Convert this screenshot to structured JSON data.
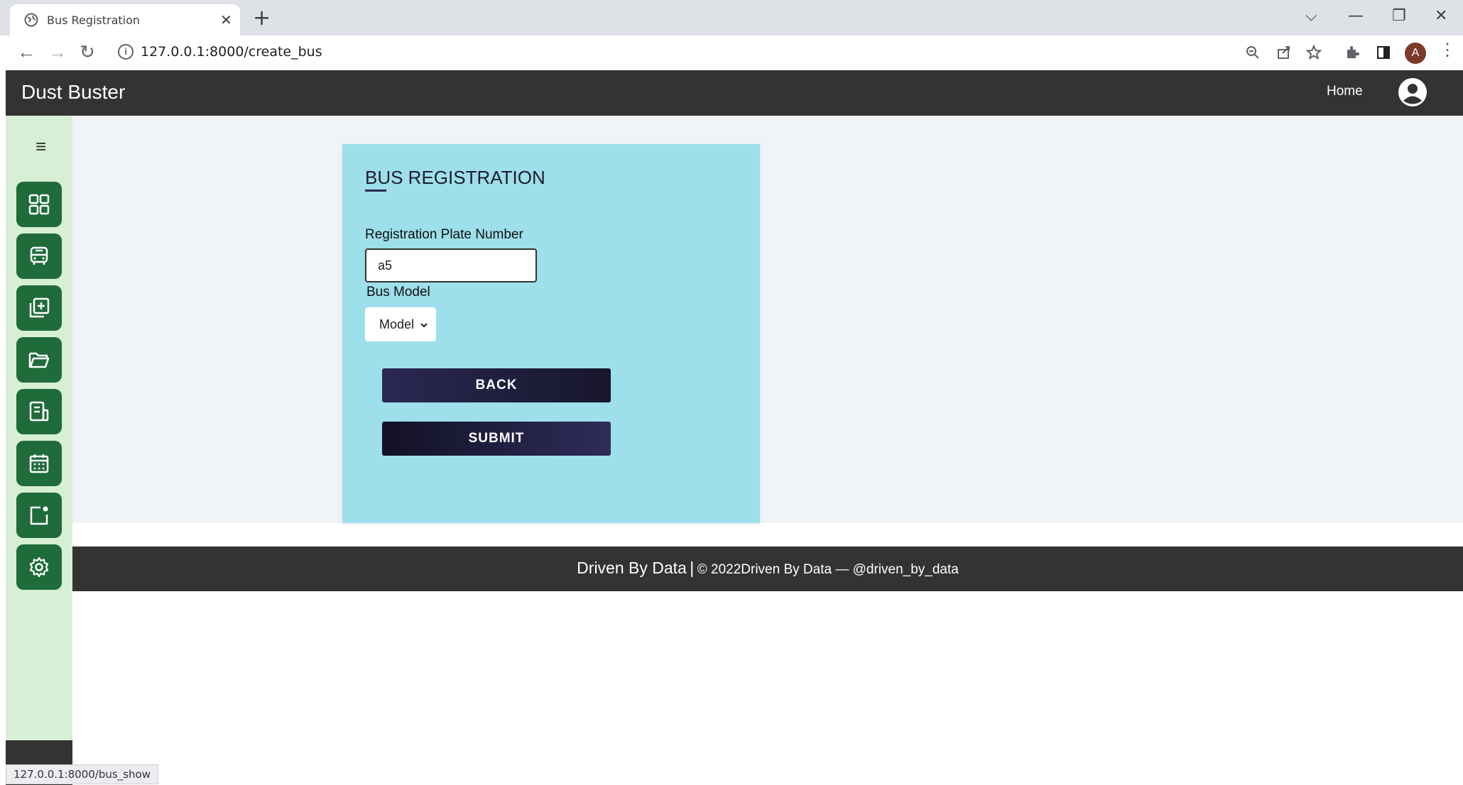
{
  "browser": {
    "tab_title": "Bus Registration",
    "tab_close": "✕",
    "new_tab": "+",
    "url": "127.0.0.1:8000/create_bus",
    "profile_initial": "A",
    "status_url": "127.0.0.1:8000/bus_show"
  },
  "header": {
    "brand": "Dust Buster",
    "home_label": "Home"
  },
  "sidebar": {
    "items": [
      {
        "icon": "dashboard-grid-icon"
      },
      {
        "icon": "bus-icon"
      },
      {
        "icon": "add-copy-icon"
      },
      {
        "icon": "folder-open-icon"
      },
      {
        "icon": "document-list-icon"
      },
      {
        "icon": "calendar-icon"
      },
      {
        "icon": "notification-card-icon"
      },
      {
        "icon": "settings-gear-icon"
      }
    ]
  },
  "form": {
    "title": "BUS REGISTRATION",
    "plate_label": "Registration Plate Number",
    "plate_value": "a5",
    "model_label": "Bus Model",
    "model_selected": "Model",
    "back_label": "BACK",
    "submit_label": "SUBMIT"
  },
  "footer": {
    "brand": "Driven By Data",
    "separator": "|",
    "copyright": "© 2022Driven By Data — @driven_by_data"
  },
  "colors": {
    "sidebar_bg": "#d6efd5",
    "sidebar_button": "#1f6b3a",
    "card_bg": "#9ddfea",
    "header_bg": "#333333",
    "button_dark": "#1d1b3a"
  }
}
